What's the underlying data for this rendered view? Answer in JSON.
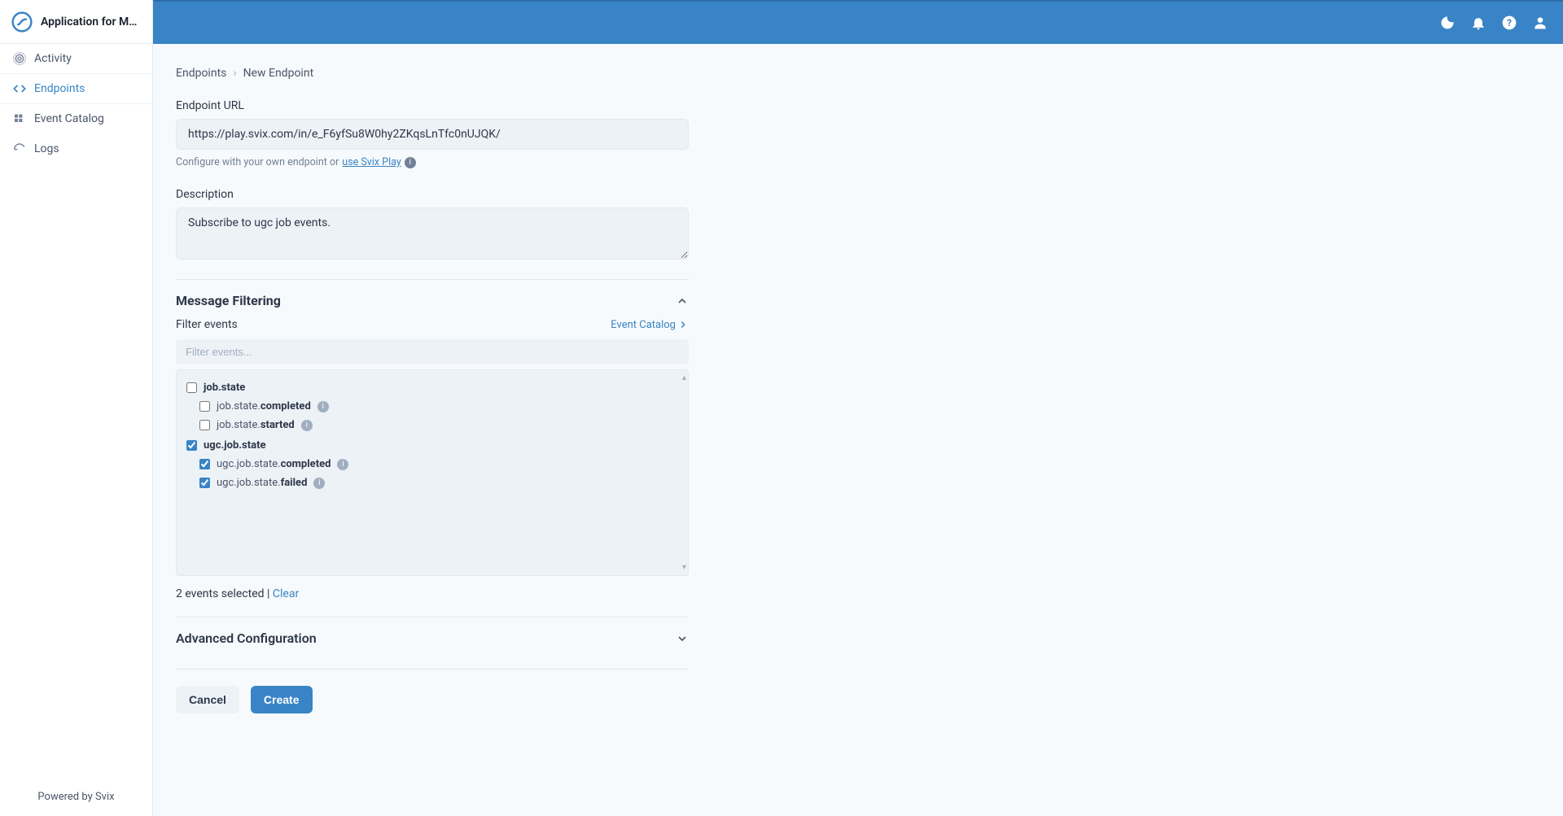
{
  "header": {
    "app_title": "Application for Mov…"
  },
  "sidebar": {
    "items": [
      {
        "label": "Activity"
      },
      {
        "label": "Endpoints"
      },
      {
        "label": "Event Catalog"
      },
      {
        "label": "Logs"
      }
    ],
    "footer": "Powered by Svix"
  },
  "breadcrumb": {
    "parent": "Endpoints",
    "current": "New Endpoint"
  },
  "form": {
    "url_label": "Endpoint URL",
    "url_value": "https://play.svix.com/in/e_F6yfSu8W0hy2ZKqsLnTfc0nUJQK/",
    "url_helper_prefix": "Configure with your own endpoint or ",
    "url_helper_link": "use Svix Play",
    "desc_label": "Description",
    "desc_value": "Subscribe to ugc job events."
  },
  "filtering": {
    "title": "Message Filtering",
    "filter_label": "Filter events",
    "catalog_link": "Event Catalog",
    "filter_placeholder": "Filter events...",
    "groups": [
      {
        "name": "job.state",
        "checked": false,
        "children": [
          {
            "prefix": "job.state.",
            "suffix": "completed",
            "checked": false
          },
          {
            "prefix": "job.state.",
            "suffix": "started",
            "checked": false
          }
        ]
      },
      {
        "name": "ugc.job.state",
        "checked": true,
        "children": [
          {
            "prefix": "ugc.job.state.",
            "suffix": "completed",
            "checked": true
          },
          {
            "prefix": "ugc.job.state.",
            "suffix": "failed",
            "checked": true
          }
        ]
      }
    ],
    "selected_text": "2 events selected",
    "clear": "Clear"
  },
  "advanced": {
    "title": "Advanced Configuration"
  },
  "buttons": {
    "cancel": "Cancel",
    "create": "Create"
  }
}
